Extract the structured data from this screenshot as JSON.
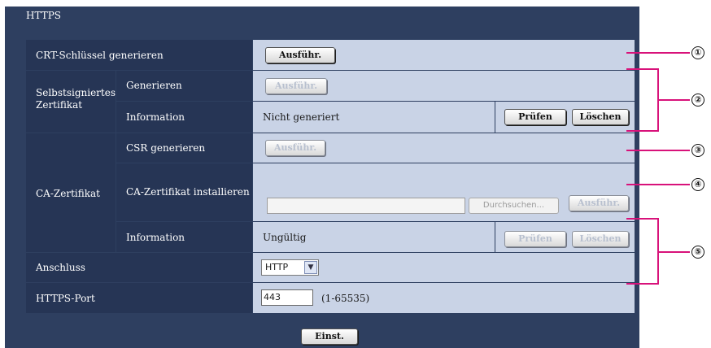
{
  "section_title": "HTTPS",
  "rows": {
    "crt": {
      "label": "CRT-Schlüssel generieren",
      "button": "Ausführ."
    },
    "self_signed": {
      "label": "Selbstsigniertes Zertifikat",
      "generate": {
        "label": "Generieren",
        "button": "Ausführ."
      },
      "information": {
        "label": "Information",
        "value": "Nicht generiert",
        "check": "Prüfen",
        "delete": "Löschen"
      }
    },
    "ca": {
      "label": "CA-Zertifikat",
      "csr": {
        "label": "CSR generieren",
        "button": "Ausführ."
      },
      "install": {
        "label": "CA-Zertifikat installieren",
        "browse": "Durchsuchen...",
        "button": "Ausführ."
      },
      "information": {
        "label": "Information",
        "value": "Ungültig",
        "check": "Prüfen",
        "delete": "Löschen"
      }
    },
    "connection": {
      "label": "Anschluss",
      "selected": "HTTP"
    },
    "port": {
      "label": "HTTPS-Port",
      "value": "443",
      "range": "(1-65535)"
    }
  },
  "submit": "Einst.",
  "callouts": [
    "①",
    "②",
    "③",
    "④",
    "⑤"
  ],
  "colors": {
    "accent_callout": "#d8127a",
    "frame": "#2e3f60",
    "cell": "#c9d3e6"
  }
}
